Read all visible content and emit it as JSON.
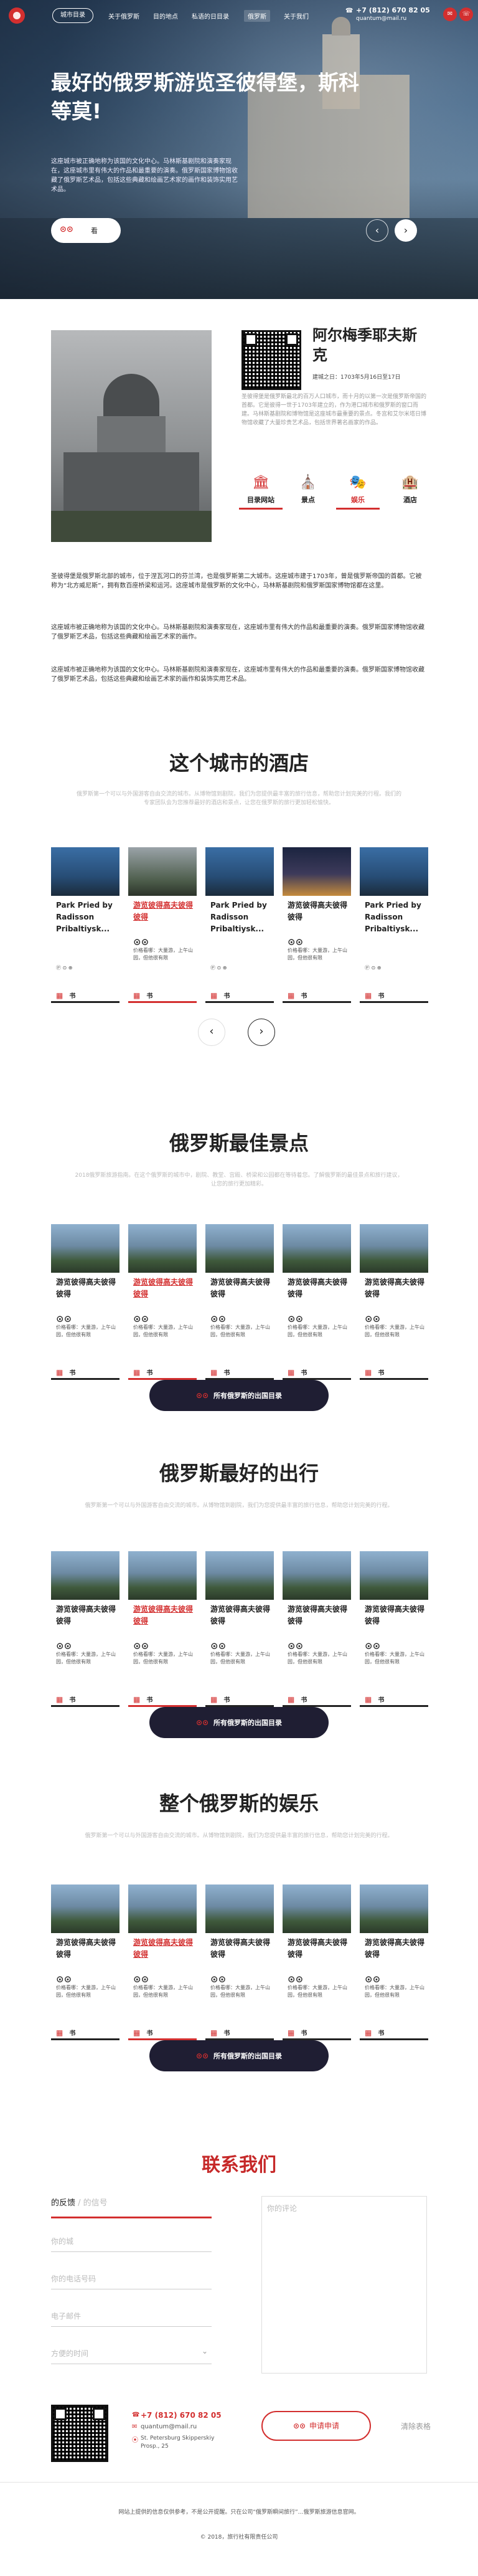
{
  "nav": {
    "catalog_btn": "城市目录",
    "links": [
      "关于俄罗斯",
      "目的地点",
      "私语的日目录",
      "俄罗斯",
      "关于我们"
    ],
    "active_index": 3,
    "phone": "+7 (812) 670 82 05",
    "email": "quantum@mail.ru"
  },
  "hero": {
    "title": "最好的俄罗斯游览圣彼得堡，斯科等莫!",
    "text": "这座城市被正确地称为该国的文化中心。马林斯基剧院和演奏家现在，这座城市里有伟大的作品和最重要的演奏。俄罗斯国家博物馆收藏了俄罗斯艺术品，包括这些典藏和绘画艺术家的画作和装饰实用艺术品。",
    "pill_logo": "⊙⊙",
    "pill_label": "看"
  },
  "attraction": {
    "title": "阿尔梅季耶夫斯克",
    "date": "建城之日：1703年5月16日至17日",
    "desc": "圣彼得堡是俄罗斯最北的百万人口城市，而十月的以第一次是俄罗斯帝国的首都。它是彼得一世于1703年建立的，作为港口城市和俄罗斯的窗口而建。马林斯基剧院和博物馆是这座城市最重要的景点。冬宫和艾尔米塔日博物馆收藏了大量珍贵艺术品，包括世界著名画家的作品。",
    "features": [
      {
        "icon": "🏛",
        "label": "目录网站"
      },
      {
        "icon": "⛪",
        "label": "景点"
      },
      {
        "icon": "🎭",
        "label": "娱乐"
      },
      {
        "icon": "🏨",
        "label": "酒店"
      }
    ],
    "paragraphs": [
      "圣彼得堡是俄罗斯北部的城市，位于涅瓦河口的芬兰湾，也是俄罗斯第二大城市。这座城市建于1703年，曾是俄罗斯帝国的首都。它被称为“北方威尼斯”，拥有数百座桥梁和运河。这座城市是俄罗斯的文化中心，马林斯基剧院和俄罗斯国家博物馆都在这里。",
      "这座城市被正确地称为该国的文化中心。马林斯基剧院和演奏家现在，这座城市里有伟大的作品和最重要的演奏。俄罗斯国家博物馆收藏了俄罗斯艺术品，包括这些典藏和绘画艺术家的画作。",
      "这座城市被正确地称为该国的文化中心。马林斯基剧院和演奏家现在，这座城市里有伟大的作品和最重要的演奏。俄罗斯国家博物馆收藏了俄罗斯艺术品，包括这些典藏和绘画艺术家的画作和装饰实用艺术品。"
    ]
  },
  "hotels": {
    "title": "这个城市的酒店",
    "desc": "俄罗斯第一个可以与外国游客自由交流的城市。从博物馆到剧院，我们为您提供最丰富的旅行信息，帮助您计划完美的行程。我们的专家团队会为您推荐最好的酒店和景点，让您在俄罗斯的旅行更加轻松愉快。",
    "cards": [
      {
        "name": "Park Pried by Radisson Pribaltiysk...",
        "meta": "Ⓟ ⊙ ⊕",
        "book": "书"
      },
      {
        "name": "游览彼得高夫彼得彼得",
        "sub_logo": "⊙⊙",
        "sub": "价格看哪：大量游，上午山园，但他很有限",
        "book": "书"
      },
      {
        "name": "Park Pried by Radisson Pribaltiysk...",
        "meta": "Ⓟ ⊙ ⊕",
        "book": "书"
      },
      {
        "name": "游览彼得高夫彼得彼得",
        "sub_logo": "⊙⊙",
        "sub": "价格看哪：大量游，上午山园，但他很有限",
        "book": "书"
      },
      {
        "name": "Park Pried by Radisson Pribaltiysk...",
        "meta": "Ⓟ ⊙ ⊕",
        "book": "书"
      }
    ]
  },
  "sights": {
    "title": "俄罗斯最佳景点",
    "desc": "2018俄罗斯旅游指南。在这个俄罗斯的城市中，剧院、教堂、宫殿、桥梁和公园都在等待着您。了解俄罗斯的最佳景点和旅行建议，让您的旅行更加精彩。",
    "card_name": "游览彼得高夫彼得彼得",
    "card_sub": "价格看哪：大量游，上午山园，但他很有限",
    "book": "书",
    "button": "所有俄罗斯的出国目录"
  },
  "trips": {
    "title": "俄罗斯最好的出行",
    "desc": "俄罗斯第一个可以与外国游客自由交流的城市。从博物馆到剧院，我们为您提供最丰富的旅行信息，帮助您计划完美的行程。",
    "button": "所有俄罗斯的出国目录"
  },
  "fun": {
    "title": "整个俄罗斯的娱乐",
    "desc": "俄罗斯第一个可以与外国游客自由交流的城市。从博物馆到剧院，我们为您提供最丰富的旅行信息，帮助您计划完美的行程。",
    "button": "所有俄罗斯的出国目录"
  },
  "contact": {
    "title": "联系我们",
    "tab_on": "的反馈",
    "tab_off": "/ 的信号",
    "fields": [
      "你的城",
      "你的电话号码",
      "电子邮件",
      "方便的时间"
    ],
    "comment_placeholder": "你的评论",
    "phone": "+7 (812) 670 82 05",
    "email": "quantum@mail.ru",
    "address": "St. Petersburg Skipperskiy Prosp., 25",
    "submit": "申请申请",
    "reset": "清除表格"
  },
  "footer": {
    "text": "网站上提供的信息仅供参考，不是公开提醒。只在公司“俄罗斯瞬间旅行”…俄罗斯旅游信息官网。",
    "copy": "© 2018，旅行社有限责任公司"
  },
  "colors": {
    "accent": "#d32f2f",
    "dark": "#1f1e33"
  }
}
